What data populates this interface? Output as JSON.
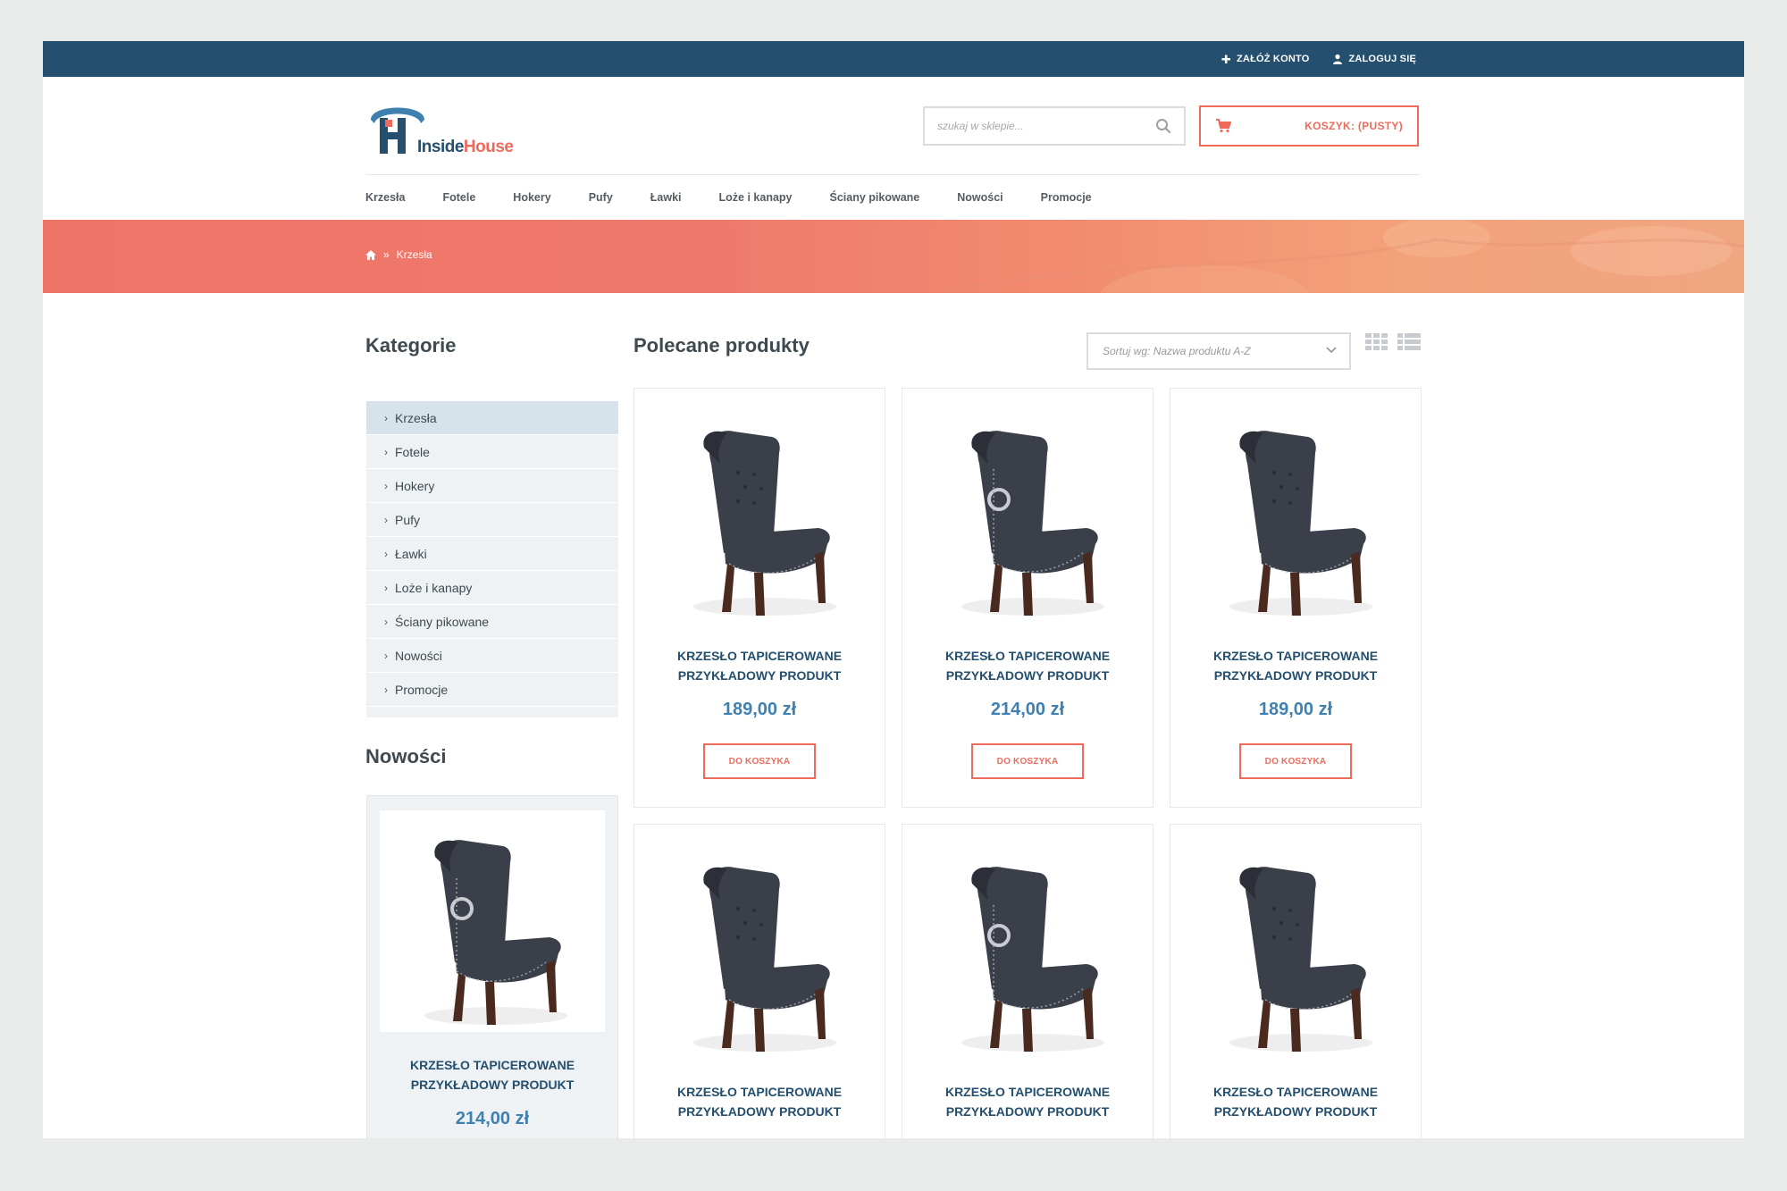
{
  "topbar": {
    "register_label": "ZAŁÓŻ KONTO",
    "login_label": "ZALOGUJ SIĘ"
  },
  "brand": {
    "part1": "Inside",
    "part2": "House"
  },
  "search": {
    "placeholder": "szukaj w sklepie..."
  },
  "cart": {
    "label": "KOSZYK: (PUSTY)"
  },
  "nav": [
    "Krzesła",
    "Fotele",
    "Hokery",
    "Pufy",
    "Ławki",
    "Loże i kanapy",
    "Ściany pikowane",
    "Nowości",
    "Promocje"
  ],
  "breadcrumb": {
    "separator": "»",
    "current": "Krzesła"
  },
  "sidebar": {
    "categories_title": "Kategorie",
    "categories": [
      "Krzesła",
      "Fotele",
      "Hokery",
      "Pufy",
      "Ławki",
      "Loże i kanapy",
      "Ściany pikowane",
      "Nowości",
      "Promocje"
    ],
    "active_category": "Krzesła",
    "new_title": "Nowości",
    "new_product": {
      "name_line1": "KRZESŁO TAPICEROWANE",
      "name_line2": "PRZYKŁADOWY PRODUKT",
      "price": "214,00 zł"
    }
  },
  "main": {
    "title": "Polecane produkty",
    "sort_label": "Sortuj wg: Nazwa produktu A-Z",
    "add_to_cart_label": "DO KOSZYKA",
    "products": [
      {
        "name_line1": "KRZESŁO TAPICEROWANE",
        "name_line2": "PRZYKŁADOWY PRODUKT",
        "price": "189,00 zł",
        "view": "front"
      },
      {
        "name_line1": "KRZESŁO TAPICEROWANE",
        "name_line2": "PRZYKŁADOWY PRODUKT",
        "price": "214,00 zł",
        "view": "back"
      },
      {
        "name_line1": "KRZESŁO TAPICEROWANE",
        "name_line2": "PRZYKŁADOWY PRODUKT",
        "price": "189,00 zł",
        "view": "front"
      },
      {
        "name_line1": "KRZESŁO TAPICEROWANE",
        "name_line2": "PRZYKŁADOWY PRODUKT",
        "price": "",
        "view": "front"
      },
      {
        "name_line1": "KRZESŁO TAPICEROWANE",
        "name_line2": "PRZYKŁADOWY PRODUKT",
        "price": "",
        "view": "back"
      },
      {
        "name_line1": "KRZESŁO TAPICEROWANE",
        "name_line2": "PRZYKŁADOWY PRODUKT",
        "price": "",
        "view": "front"
      }
    ]
  },
  "colors": {
    "topbar": "#244f6e",
    "accent": "#ee6b5c",
    "price": "#3f80b0",
    "product_name": "#244f6e",
    "chair_fabric": "#3b3f4a",
    "chair_legs": "#4a2a1e"
  },
  "icons": [
    "plus-icon",
    "user-icon",
    "search-icon",
    "cart-icon",
    "home-icon",
    "chevron-right-icon",
    "chevron-down-icon",
    "grid-view-icon",
    "list-view-icon"
  ]
}
